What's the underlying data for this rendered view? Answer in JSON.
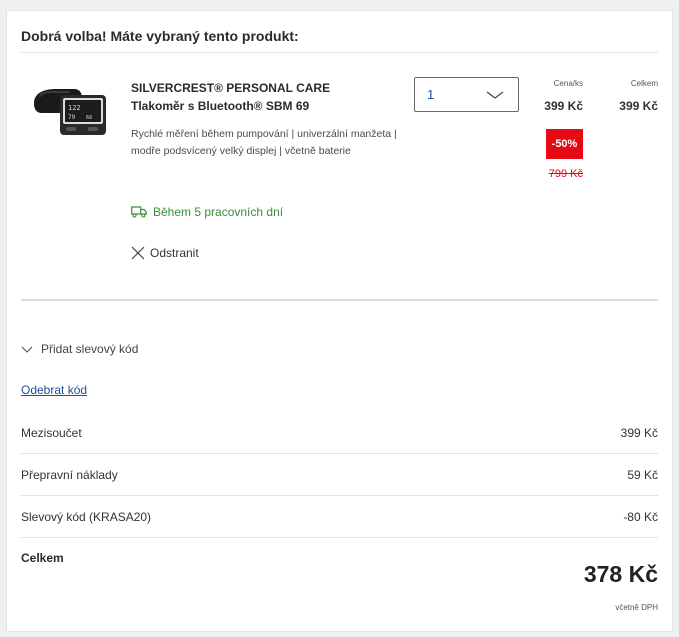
{
  "header": {
    "title": "Dobrá volba! Máte vybraný tento produkt:"
  },
  "product": {
    "name": "SILVERCREST® PERSONAL CARE Tlakoměr s Bluetooth® SBM 69",
    "description": "Rychlé měření během pumpování | univerzální manžeta | modře podsvícený velký displej | včetně baterie",
    "delivery": "Během 5 pracovních dní",
    "remove_label": "Odstranit",
    "quantity": "1",
    "unit_price_header": "Cena/ks",
    "total_header": "Celkem",
    "unit_price": "399 Kč",
    "total_price": "399 Kč",
    "discount_badge": "-50%",
    "old_price": "799 Kč"
  },
  "coupon": {
    "toggle_label": "Přidat slevový kód",
    "remove_code_link": "Odebrat kód"
  },
  "summary": {
    "rows": [
      {
        "label": "Mezisoučet",
        "value": "399 Kč"
      },
      {
        "label": "Přepravní náklady",
        "value": "59 Kč"
      },
      {
        "label": "Slevový kód (KRASA20)",
        "value": "-80 Kč"
      }
    ],
    "total_label": "Celkem",
    "total_value": "378 Kč",
    "vat_note": "včetně DPH"
  },
  "colors": {
    "accent_blue": "#1f4e9c",
    "discount_red": "#e60a14",
    "delivery_green": "#3c8c3c"
  },
  "icons": {
    "delivery": "truck-icon",
    "remove": "close-icon",
    "select": "chevron-down-icon",
    "coupon": "chevron-down-icon"
  }
}
